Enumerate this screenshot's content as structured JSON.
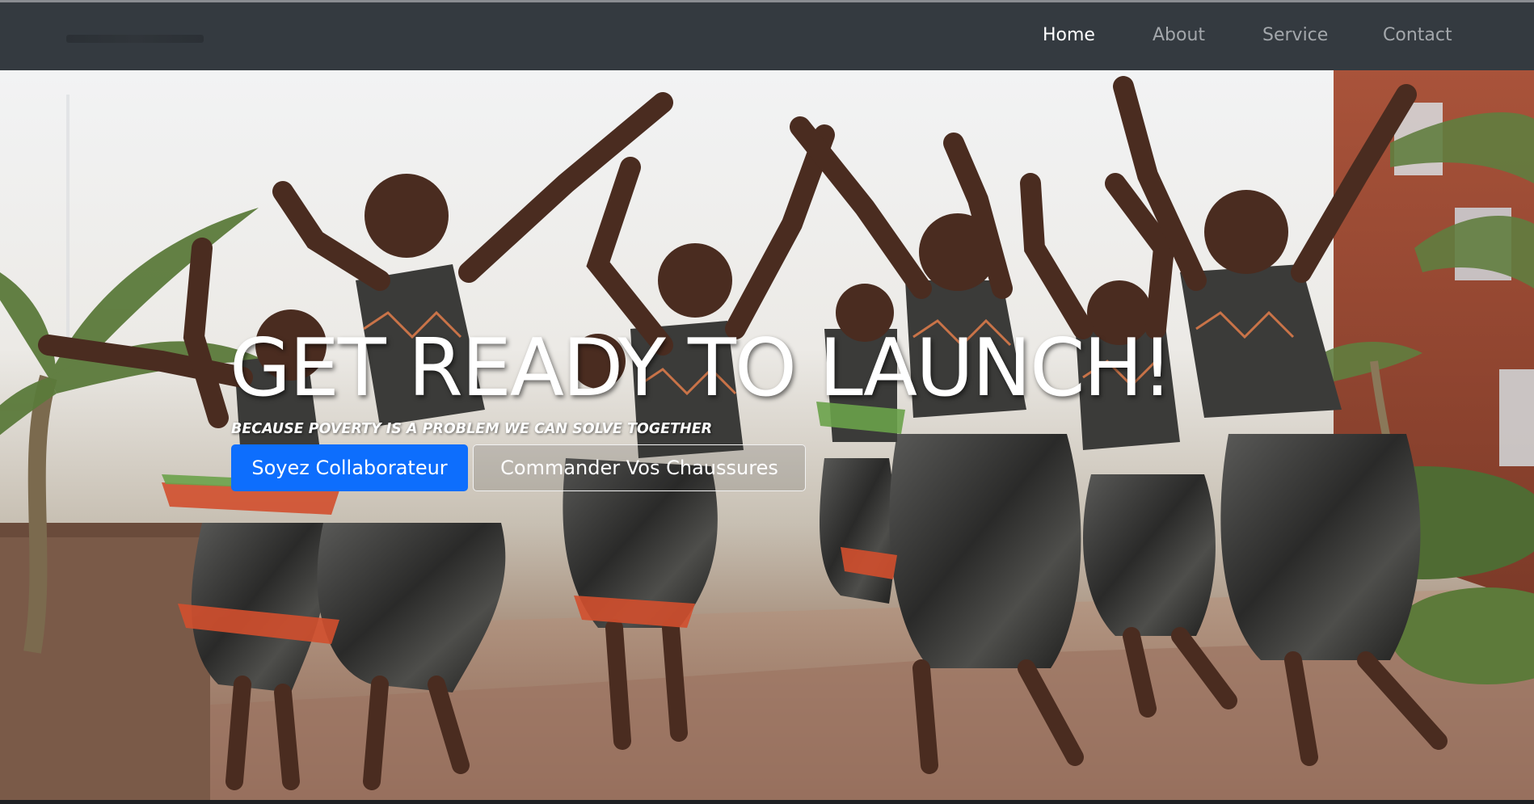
{
  "nav": {
    "items": [
      {
        "label": "Home",
        "active": true
      },
      {
        "label": "About",
        "active": false
      },
      {
        "label": "Service",
        "active": false
      },
      {
        "label": "Contact",
        "active": false
      }
    ]
  },
  "hero": {
    "title": "GET READY TO LAUNCH!",
    "tagline": "BECAUSE POVERTY IS A PROBLEM WE CAN SOLVE TOGETHER",
    "primary_button": "Soyez Collaborateur",
    "secondary_button": "Commander Vos Chaussures"
  },
  "colors": {
    "navbar": "#343a40",
    "nav_active": "#ffffff",
    "nav_inactive": "#a3a7ab",
    "primary": "#0d6efd"
  }
}
